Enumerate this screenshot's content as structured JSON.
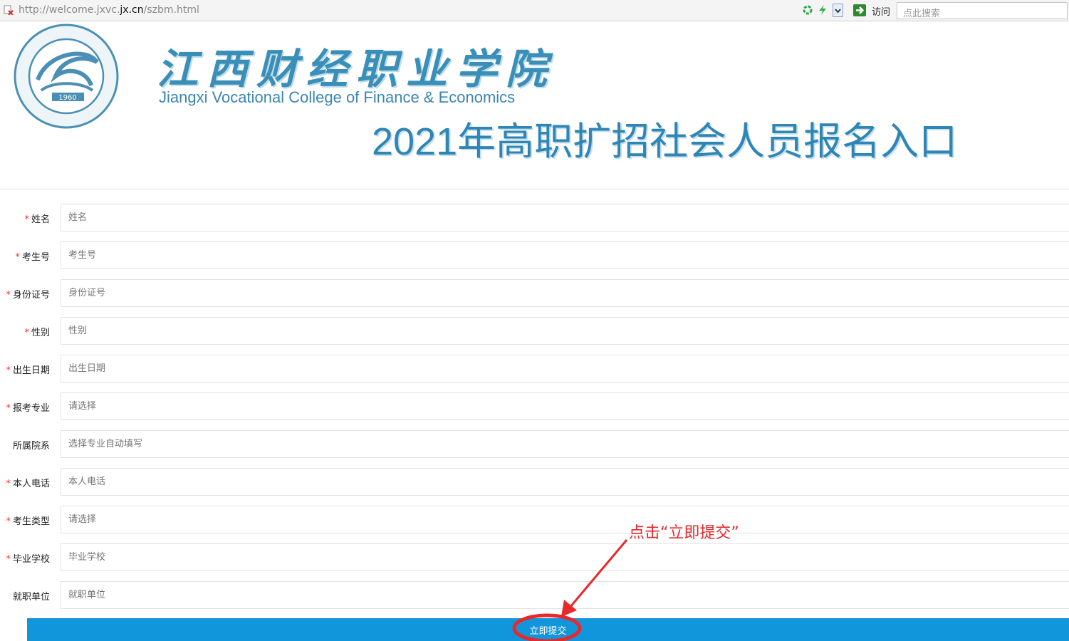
{
  "browser": {
    "url_prefix": "http://welcome.jxvc.",
    "url_domain": "jx.cn",
    "url_suffix": "/szbm.html",
    "visit_label": "访问",
    "search_placeholder": "点此搜索"
  },
  "header": {
    "school_name_cn": "江西财经职业学院",
    "school_name_en": "Jiangxi Vocational College of Finance & Economics",
    "headline": "2021年高职扩招社会人员报名入口",
    "seal_year": "1960"
  },
  "form": {
    "fields": [
      {
        "label": "姓名",
        "required": "*",
        "placeholder": "姓名"
      },
      {
        "label": "考生号",
        "required": "*",
        "placeholder": "考生号"
      },
      {
        "label": "身份证号",
        "required": "*",
        "placeholder": "身份证号"
      },
      {
        "label": "性别",
        "required": "*",
        "placeholder": "性别"
      },
      {
        "label": "出生日期",
        "required": "*",
        "placeholder": "出生日期"
      },
      {
        "label": "报考专业",
        "required": "*",
        "placeholder": "请选择"
      },
      {
        "label": "所属院系",
        "required": "",
        "placeholder": "选择专业自动填写"
      },
      {
        "label": "本人电话",
        "required": "*",
        "placeholder": "本人电话"
      },
      {
        "label": "考生类型",
        "required": "*",
        "placeholder": "请选择"
      },
      {
        "label": "毕业学校",
        "required": "*",
        "placeholder": "毕业学校"
      },
      {
        "label": "就职单位",
        "required": "",
        "placeholder": "就职单位"
      }
    ],
    "submit_label": "立即提交"
  },
  "annotation": {
    "text": "点击“立即提交”",
    "color": "#e8282b"
  }
}
